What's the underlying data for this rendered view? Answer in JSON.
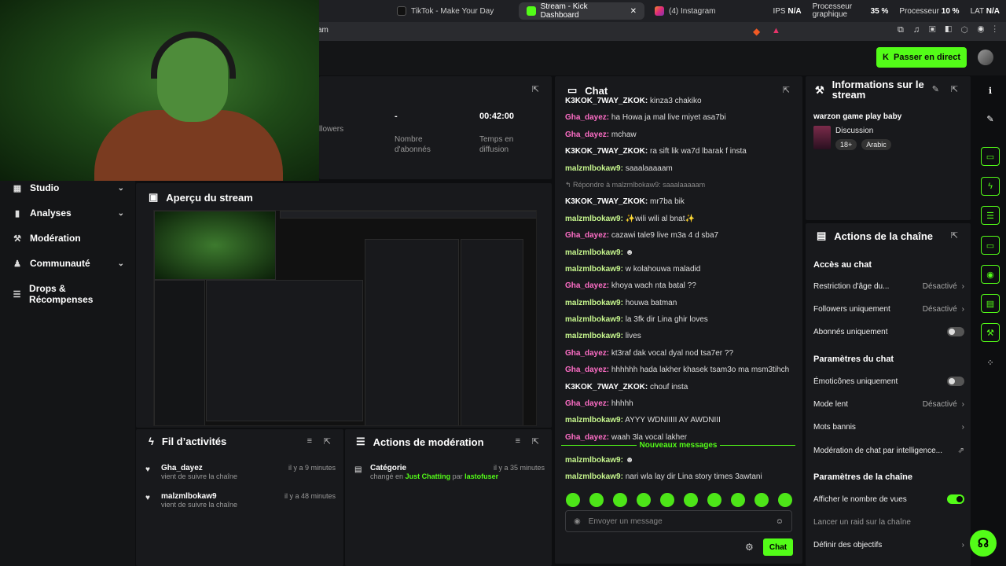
{
  "browser": {
    "tabs": [
      {
        "label": "TikTok - Make Your Day"
      },
      {
        "label": "Stream - Kick Dashboard"
      },
      {
        "label": "(4) Instagram"
      }
    ],
    "perf": {
      "ips_label": "IPS",
      "ips": "N/A",
      "gpu_label": "Processeur graphique",
      "gpu": "35 %",
      "cpu_label": "Processeur",
      "cpu": "10 %",
      "lat_label": "LAT",
      "lat": "N/A"
    },
    "url": "am"
  },
  "topbar": {
    "golive": "Passer en direct"
  },
  "sidebar": {
    "items": [
      {
        "label": "Studio",
        "chev": true
      },
      {
        "label": "Analyses",
        "chev": true
      },
      {
        "label": "Modération",
        "chev": false
      },
      {
        "label": "Communauté",
        "chev": true
      },
      {
        "label": "Drops & Récompenses",
        "chev": false
      }
    ]
  },
  "stats": {
    "items": [
      {
        "value": "",
        "label": "llowers"
      },
      {
        "value": "-",
        "label": "Nombre d'abonnés"
      },
      {
        "value": "00:42:00",
        "label": "Temps en diffusion"
      }
    ]
  },
  "preview": {
    "title": "Aperçu du stream"
  },
  "feed": {
    "title": "Fil d’activités",
    "items": [
      {
        "user": "Gha_dayez",
        "time": "il y a 9 minutes",
        "sub": "vient de suivre la chaîne"
      },
      {
        "user": "malzmlbokaw9",
        "time": "il y a 48 minutes",
        "sub": "vient de suivre la chaîne"
      }
    ]
  },
  "modactions": {
    "title": "Actions de modération",
    "item": {
      "name": "Catégorie",
      "time": "il y a 35 minutes",
      "changed": "changé en",
      "category": "Just Chatting",
      "by": "par",
      "who": "lastofuser"
    }
  },
  "chat": {
    "title": "Chat",
    "messages": [
      {
        "user": "K3KOK_7WAY_ZKOK:",
        "text": "kinza3 chakiko",
        "color": "#ffffff"
      },
      {
        "user": "Gha_dayez:",
        "text": "ha Howa ja mal live miyet asa7bi",
        "color": "#ff6ec7"
      },
      {
        "user": "Gha_dayez:",
        "text": "mchaw",
        "color": "#ff6ec7"
      },
      {
        "user": "K3KOK_7WAY_ZKOK:",
        "text": "ra sift lik wa7d lbarak f insta",
        "color": "#ffffff"
      },
      {
        "user": "malzmlbokaw9:",
        "text": "saaalaaaaam",
        "color": "#c6f68d"
      },
      {
        "user": "",
        "text": "↰ Répondre à malzmlbokaw9: saaalaaaaam",
        "color": "#888888",
        "reply": true
      },
      {
        "user": "K3KOK_7WAY_ZKOK:",
        "text": "mr7ba bik",
        "color": "#ffffff"
      },
      {
        "user": "malzmlbokaw9:",
        "text": "✨wili wili al bnat✨",
        "color": "#c6f68d"
      },
      {
        "user": "Gha_dayez:",
        "text": "cazawi tale9 live m3a 4 d sba7",
        "color": "#ff6ec7"
      },
      {
        "user": "malzmlbokaw9:",
        "text": "☻",
        "color": "#c6f68d"
      },
      {
        "user": "malzmlbokaw9:",
        "text": "w kolahouwa maladid",
        "color": "#c6f68d"
      },
      {
        "user": "Gha_dayez:",
        "text": "khoya wach nta batal ??",
        "color": "#ff6ec7"
      },
      {
        "user": "malzmlbokaw9:",
        "text": "houwa batman",
        "color": "#c6f68d"
      },
      {
        "user": "malzmlbokaw9:",
        "text": "la 3fk dir Lina ghir loves",
        "color": "#c6f68d"
      },
      {
        "user": "malzmlbokaw9:",
        "text": "lives",
        "color": "#c6f68d"
      },
      {
        "user": "Gha_dayez:",
        "text": "kt3raf dak vocal dyal nod tsa7er ??",
        "color": "#ff6ec7"
      },
      {
        "user": "Gha_dayez:",
        "text": "hhhhhh hada lakher khasek tsam3o ma msm3tihch",
        "color": "#ff6ec7"
      },
      {
        "user": "K3KOK_7WAY_ZKOK:",
        "text": "chouf insta",
        "color": "#ffffff"
      },
      {
        "user": "Gha_dayez:",
        "text": "hhhhh",
        "color": "#ff6ec7"
      },
      {
        "user": "malzmlbokaw9:",
        "text": "AYYY WDNIIIII AY AWDNIII",
        "color": "#c6f68d"
      },
      {
        "user": "Gha_dayez:",
        "text": "waah 3la vocal lakher",
        "color": "#ff6ec7"
      }
    ],
    "newmsg": "Nouveaux messages",
    "after": [
      {
        "user": "malzmlbokaw9:",
        "text": "☻",
        "color": "#c6f68d"
      },
      {
        "user": "malzmlbokaw9:",
        "text": "nari wla lay dir Lina story times 3awtani",
        "color": "#c6f68d"
      }
    ],
    "placeholder": "Envoyer un message",
    "send": "Chat"
  },
  "info": {
    "title": "Informations sur le stream",
    "stream_title": "warzon game play baby",
    "category": "Discussion",
    "tags": [
      "18+",
      "Arabic"
    ]
  },
  "actions": {
    "title": "Actions de la chaîne",
    "s1": "Accès au chat",
    "r1": {
      "label": "Restriction d'âge du...",
      "value": "Désactivé"
    },
    "r2": {
      "label": "Followers uniquement",
      "value": "Désactivé"
    },
    "r3": {
      "label": "Abonnés uniquement"
    },
    "s2": "Paramètres du chat",
    "r4": {
      "label": "Émoticônes uniquement"
    },
    "r5": {
      "label": "Mode lent",
      "value": "Désactivé"
    },
    "r6": {
      "label": "Mots bannis"
    },
    "r7": {
      "label": "Modération de chat par intelligence..."
    },
    "s3": "Paramètres de la chaîne",
    "r8": {
      "label": "Afficher le nombre de vues"
    },
    "r9": {
      "label": "Lancer un raid sur la chaîne"
    },
    "r10": {
      "label": "Définir des objectifs"
    }
  },
  "colors": {
    "accent": "#53fc18",
    "bg": "#0d0e10",
    "panel": "#18191c"
  }
}
